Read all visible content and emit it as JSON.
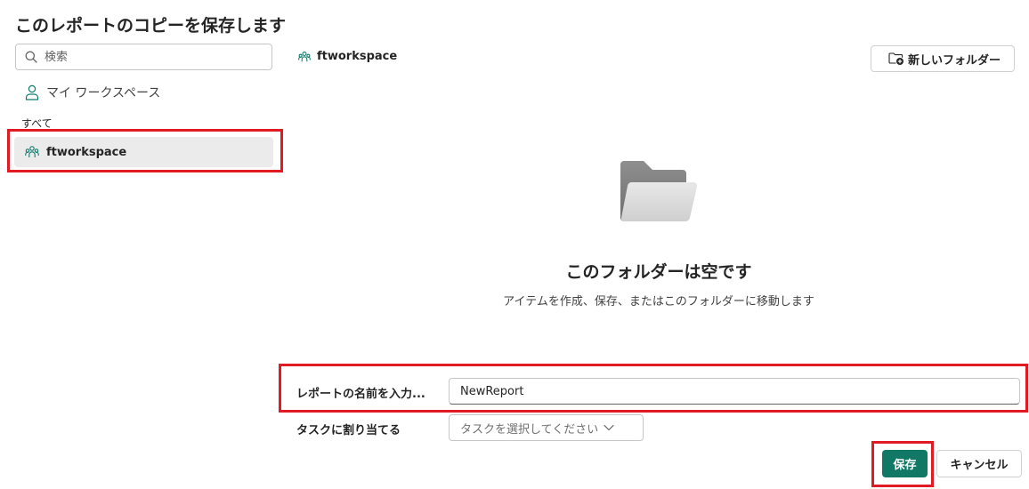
{
  "dialog": {
    "title": "このレポートのコピーを保存します"
  },
  "sidebar": {
    "search_placeholder": "検索",
    "my_workspace_label": "マイ ワークスペース",
    "all_label": "すべて",
    "workspaces": [
      {
        "label": "ftworkspace",
        "selected": true
      }
    ]
  },
  "main": {
    "breadcrumb": "ftworkspace",
    "new_folder_label": "新しいフォルダー",
    "empty_title": "このフォルダーは空です",
    "empty_subtitle": "アイテムを作成、保存、またはこのフォルダーに移動します"
  },
  "form": {
    "name_label": "レポートの名前を入力...",
    "name_value": "NewReport",
    "task_label": "タスクに割り当てる",
    "task_placeholder": "タスクを選択してください"
  },
  "footer": {
    "save_label": "保存",
    "cancel_label": "キャンセル"
  },
  "colors": {
    "accent": "#117865",
    "highlight": "#e01b24",
    "workspace_icon": "#0f7b6c"
  }
}
